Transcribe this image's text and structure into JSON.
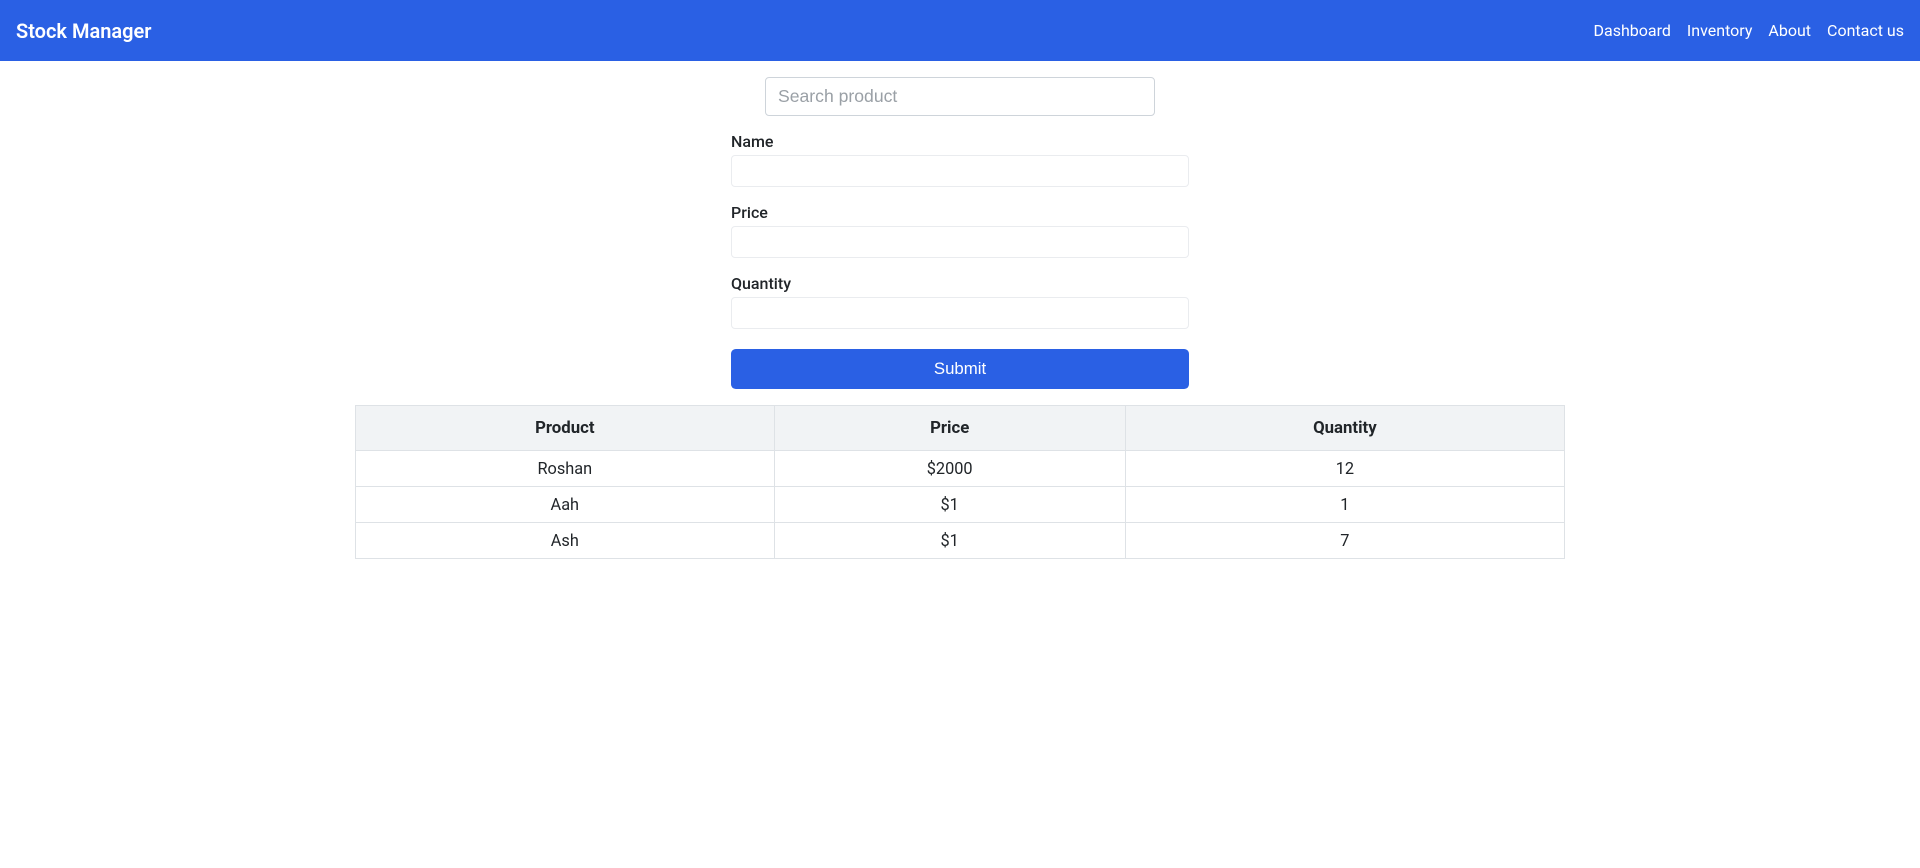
{
  "navbar": {
    "brand": "Stock Manager",
    "links": [
      {
        "label": "Dashboard"
      },
      {
        "label": "Inventory"
      },
      {
        "label": "About"
      },
      {
        "label": "Contact us"
      }
    ]
  },
  "search": {
    "placeholder": "Search product",
    "value": ""
  },
  "form": {
    "name_label": "Name",
    "name_value": "",
    "price_label": "Price",
    "price_value": "",
    "quantity_label": "Quantity",
    "quantity_value": "",
    "submit_label": "Submit"
  },
  "table": {
    "headers": {
      "product": "Product",
      "price": "Price",
      "quantity": "Quantity"
    },
    "rows": [
      {
        "product": "Roshan",
        "price": "$2000",
        "quantity": "12"
      },
      {
        "product": "Aah",
        "price": "$1",
        "quantity": "1"
      },
      {
        "product": "Ash",
        "price": "$1",
        "quantity": "7"
      }
    ]
  }
}
